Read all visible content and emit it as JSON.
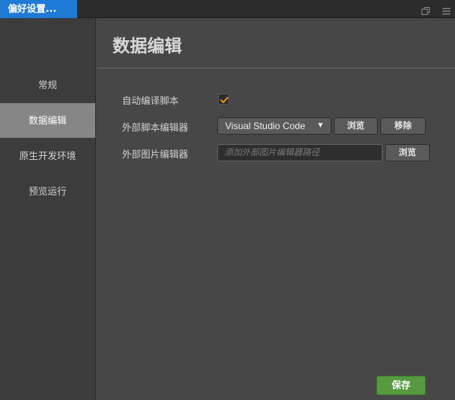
{
  "window": {
    "tab_title": "偏好设置..."
  },
  "sidebar": {
    "items": [
      {
        "label": "常规"
      },
      {
        "label": "数据编辑"
      },
      {
        "label": "原生开发环境"
      },
      {
        "label": "预览运行"
      }
    ],
    "active_index": 1
  },
  "main": {
    "title": "数据编辑",
    "auto_compile": {
      "label": "自动编译脚本",
      "checked": true
    },
    "script_editor": {
      "label": "外部脚本编辑器",
      "selected": "Visual Studio Code",
      "browse_label": "浏览",
      "remove_label": "移除"
    },
    "image_editor": {
      "label": "外部图片编辑器",
      "placeholder": "添加外部图片编辑器路径",
      "value": "",
      "browse_label": "浏览"
    },
    "save_label": "保存"
  },
  "colors": {
    "accent_tab": "#1f7ad6",
    "save_button": "#569a3f",
    "checkmark": "#e8902c"
  }
}
